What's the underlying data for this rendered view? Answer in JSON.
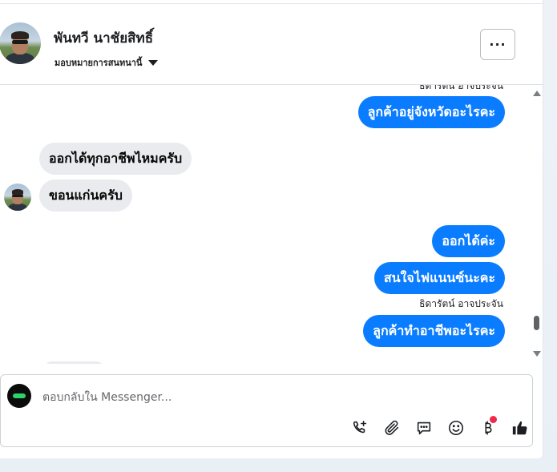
{
  "header": {
    "contact_name": "พันทวี นาชัยสิทธิ์",
    "assign_label": "มอบหมายการสนทนานี้",
    "more_label": "···"
  },
  "thread": {
    "top_partial_sender": "ธิดารัตน์ อาจประจัน",
    "messages": [
      {
        "direction": "out",
        "text": "ลูกค้าอยู่จังหวัดอะไรคะ"
      },
      {
        "direction": "in",
        "text": "ออกได้ทุกอาชีพไหมครับ"
      },
      {
        "direction": "in",
        "text": "ขอนแก่นครับ"
      },
      {
        "direction": "out",
        "text": "ออกได้ค่ะ"
      },
      {
        "direction": "out",
        "text": "สนใจไฟแนนซ์นะคะ"
      },
      {
        "direction": "out",
        "text": "ลูกค้าทำอาชีพอะไรคะ",
        "sender": "ธิดารัตน์ อาจประจัน"
      }
    ]
  },
  "composer": {
    "placeholder": "ตอบกลับใน Messenger...",
    "tools": [
      "phone-plus-icon",
      "paperclip-icon",
      "saved-reply-icon",
      "emoji-icon",
      "baht-payment-icon",
      "thumbs-up-icon"
    ],
    "notification_color": "#f02849"
  },
  "colors": {
    "outgoing_bubble": "#0a7cff",
    "incoming_bubble": "#e9ebee"
  }
}
